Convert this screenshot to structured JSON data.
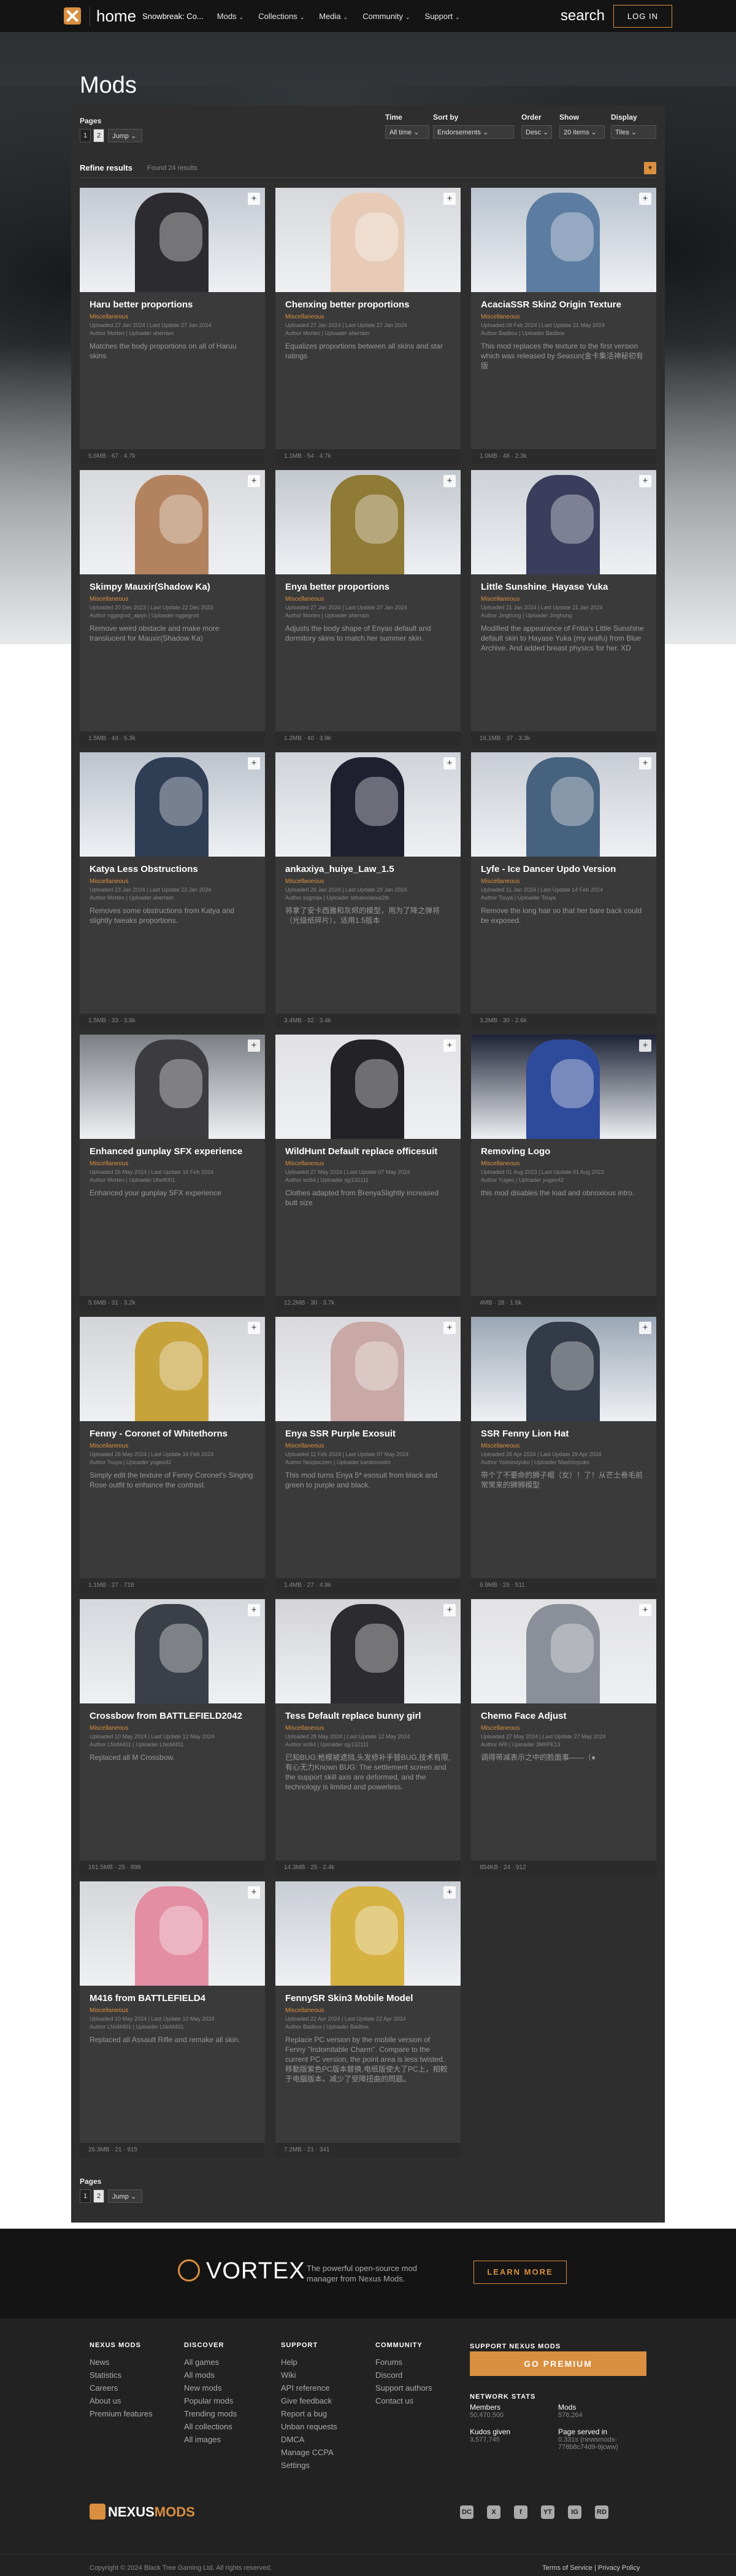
{
  "header": {
    "home": "home",
    "game": "Snowbreak: Co...",
    "nav": [
      "Mods",
      "Collections",
      "Media",
      "Community",
      "Support"
    ],
    "search": "search",
    "login": "LOG IN"
  },
  "title": "Mods",
  "filters": {
    "pages_label": "Pages",
    "pages": [
      "1",
      "2"
    ],
    "jump": "Jump",
    "time_label": "Time",
    "time_value": "All time",
    "sort_label": "Sort by",
    "sort_value": "Endorsements",
    "order_label": "Order",
    "order_value": "Desc",
    "show_label": "Show",
    "show_value": "20 items",
    "display_label": "Display",
    "display_value": "Tiles"
  },
  "refine": {
    "title": "Refine results",
    "count": "Found 24 results"
  },
  "mods": [
    {
      "name": "Haru better proportions",
      "category": "Miscellaneous",
      "dates": "Uploaded 27 Jan 2024 | Last Update 27 Jan 2024",
      "people": "Author Morten | Uploader aherram",
      "desc": "Matches the body proportions on all of Haruu skins",
      "stats": "5.6MB  ·  67  ·  4.7k",
      "bg": "#c4c9d3",
      "fig": "#2b2b30"
    },
    {
      "name": "Chenxing better proportions",
      "category": "Miscellaneous",
      "dates": "Uploaded 27 Jan 2024 | Last Update 27 Jan 2024",
      "people": "Author Morten | Uploader aherram",
      "desc": "Equalizes proportions between all skins and star ratings",
      "stats": "1.1MB  ·  54  ·  4.7k",
      "bg": "#d7d8dc",
      "fig": "#e7cbb6"
    },
    {
      "name": "AcaciaSSR Skin2 Origin Texture",
      "category": "Miscellaneous",
      "dates": "Uploaded 09 Feb 2024 | Last Update 21 May 2024",
      "people": "Author Badbox | Uploader Badbox",
      "desc": "This mod replaces the texture to the first version which was released by Seasun(金卡集活神秘初有版",
      "stats": "1.0MB  ·  48  ·  2.3k",
      "bg": "#b9c3cf",
      "fig": "#5c7da1"
    },
    {
      "name": "Skimpy Mauxir(Shadow Ka)",
      "category": "Miscellaneous",
      "dates": "Uploaded 20 Dec 2023 | Last Update 22 Dec 2023",
      "people": "Author nggegrod_alpyn | Uploader nggegrod",
      "desc": "Remove weird obstacle and make more translucent for Mauxir(Shadow Ka)",
      "stats": "1.5MB  ·  44  ·  5.3k",
      "bg": "#d8d9dd",
      "fig": "#b3835f"
    },
    {
      "name": "Enya better proportions",
      "category": "Miscellaneous",
      "dates": "Uploaded 27 Jan 2024 | Last Update 27 Jan 2024",
      "people": "Author Morten | Uploader aherram",
      "desc": "Adjusts the body shape of Enyas default and dormitory skins to match her summer skin.",
      "stats": "1.2MB  ·  40  ·  3.9k",
      "bg": "#c3c8cf",
      "fig": "#8f7a36"
    },
    {
      "name": "Little Sunshine_Hayase Yuka",
      "category": "Miscellaneous",
      "dates": "Uploaded 21 Jan 2024 | Last Update 21 Jan 2024",
      "people": "Author Jinghung | Uploader Jinghung",
      "desc": "Modified the appearance of Fritia's Little Sunshine default skin to Hayase Yuka (my waifu) from Blue Archive. And added breast physics for her. XD",
      "stats": "16.1MB  ·  37  ·  3.3k",
      "bg": "#cdd1d8",
      "fig": "#3a3d5c"
    },
    {
      "name": "Katya Less Obstructions",
      "category": "Miscellaneous",
      "dates": "Uploaded 23 Jan 2024 | Last Update 23 Jan 2024",
      "people": "Author Morten | Uploader aherram",
      "desc": "Removes some obstructions from Katya and slightly tweaks proportions.",
      "stats": "1.5MB  ·  33  ·  3.8k",
      "bg": "#bcc3cd",
      "fig": "#2f3d55"
    },
    {
      "name": "ankaxiya_huiye_Law_1.5",
      "category": "Miscellaneous",
      "dates": "Uploaded 26 Jan 2024 | Last Update 29 Jan 2024",
      "people": "Author ssgmax | Uploader sbhaoxiaoxa2tb",
      "desc": "将拿了安卡西雅和灰烬的模型，用为了降之弹将（光级纸碎片）。适用1.5版本",
      "stats": "3.4MB  ·  32  ·  3.4k",
      "bg": "#d0d3d9",
      "fig": "#1e2030"
    },
    {
      "name": "Lyfe - Ice Dancer Updo Version",
      "category": "Miscellaneous",
      "dates": "Uploaded 11 Jan 2024 | Last Update 14 Feb 2024",
      "people": "Author Tsuya | Uploader Tsuya",
      "desc": "Remove the long hair so that her bare back could be exposed.",
      "stats": "3.2MB  ·  30  ·  2.6k",
      "bg": "#c8ccd4",
      "fig": "#47627e"
    },
    {
      "name": "Enhanced gunplay SFX experience",
      "category": "Miscellaneous",
      "dates": "Uploaded 26 May 2024 | Last Update 16 Feb 2024",
      "people": "Author Morten | Uploader Ubelt001",
      "desc": "Enhanced your gunplay SFX experience",
      "stats": "5.6MB  ·  31  ·  3.2k",
      "bg": "#7b7e84",
      "fig": "#3c3c40"
    },
    {
      "name": "WildHunt Default replace officesuit",
      "category": "Miscellaneous",
      "dates": "Uploaded 27 May 2024 | Last Update 07 May 2024",
      "people": "Author sci64 | Uploader sjy132111",
      "desc": "Clothes adapted from BrenyaSlightly increased butt size",
      "stats": "12.2MB  ·  30  ·  3.7k",
      "bg": "#e1e1e4",
      "fig": "#222227"
    },
    {
      "name": "Removing Logo",
      "category": "Miscellaneous",
      "dates": "Uploaded 01 Aug 2023 | Last Update 01 Aug 2023",
      "people": "Author Yugeo | Uploader yugeo42",
      "desc": "this mod disables the load and obnoxious intro.",
      "stats": "4MB  ·  28  ·  1.6k",
      "bg": "#1d2336",
      "fig": "#2e4a9a"
    },
    {
      "name": "Fenny - Coronet of Whitethorns",
      "category": "Miscellaneous",
      "dates": "Uploaded 26 May 2024 | Last Update 16 Feb 2024",
      "people": "Author Tsuya | Uploader yugeo42",
      "desc": "Simply edit the texture of Fenny Coronet's Singing Rose outfit to enhance the contrast.",
      "stats": "1.1MB  ·  27  ·  718",
      "bg": "#d3d4d8",
      "fig": "#c7a33c"
    },
    {
      "name": "Enya SSR Purple Exosuit",
      "category": "Miscellaneous",
      "dates": "Uploaded 11 Feb 2024 | Last Update 07 May 2024",
      "people": "Author Nezpoczem | Uploader kardoovsdm",
      "desc": "This mod turns Enya 5* exosuit from black and green to purple and black.",
      "stats": "1.4MB  ·  27  ·  4.9k",
      "bg": "#d9d9dd",
      "fig": "#c8a9a5"
    },
    {
      "name": "SSR Fenny Lion Hat",
      "category": "Miscellaneous",
      "dates": "Uploaded 26 Apr 2024 | Last Update 29 Apr 2024",
      "people": "Author Yoshinoyuko | Uploader Mashiroyuko",
      "desc": "带个了不要命的狮子帽（女）！了！从芒士卷毛前常常来的狮狮模型",
      "stats": "6.9MB  ·  26  ·  511",
      "bg": "#9ba7b6",
      "fig": "#333a48"
    },
    {
      "name": "Crossbow from BATTLEFIELD2042",
      "category": "Miscellaneous",
      "dates": "Uploaded 10 May 2024 | Last Update 12 May 2024",
      "people": "Author LNoM401 | Uploader LNoM401",
      "desc": "Replaced all M Crossbow.",
      "stats": "161.5MB  ·  25  ·  998",
      "bg": "#d5d7dc",
      "fig": "#3a3f48"
    },
    {
      "name": "Tess Default replace bunny girl",
      "category": "Miscellaneous",
      "dates": "Uploaded 28 May 2024 | Last Update 12 May 2024",
      "people": "Author sci64 | Uploader sjy132111",
      "desc": "已知BUG:枪模被遮挡,头发修补手替BUG,技术有限,有心无力Known BUG: The settlement screen and the support skill axis are deformed, and the technology is limited and powerless.",
      "stats": "14.3MB  ·  25  ·  2.4k",
      "bg": "#d4d4d8",
      "fig": "#2b2b30"
    },
    {
      "name": "Chemo Face Adjust",
      "category": "Miscellaneous",
      "dates": "Uploaded 27 May 2024 | Last Update 27 May 2024",
      "people": "Author ARI | Uploader 3MIIPE13",
      "desc": "调得带减表示之中的脸面事——（●",
      "stats": "854KB  ·  24  ·  912",
      "bg": "#e2e2e4",
      "fig": "#8a8f99"
    },
    {
      "name": "M416 from BATTLEFIELD4",
      "category": "Miscellaneous",
      "dates": "Uploaded 10 May 2024 | Last Update 10 May 2024",
      "people": "Author LNoM401 | Uploader LNoM401",
      "desc": "Replaced all Assault Rifle and remake all skin.",
      "stats": "26.3MB  ·  21  ·  915",
      "bg": "#d6d7db",
      "fig": "#e38ea3"
    },
    {
      "name": "FennySR Skin3 Mobile Model",
      "category": "Miscellaneous",
      "dates": "Uploaded 22 Apr 2024 | Last Update 22 Apr 2024",
      "people": "Author Badbox | Uploader Badbox",
      "desc": "Replace PC version by the mobile version of Fenny \"Indomitable Charm\". Compare to the current PC version, the point area is less twisted.移動版紫色PC版本替换,电纸版使大了PC上，相較于电腦版本，减少了受障扭曲的問题。",
      "stats": "7.2MB  ·  21  ·  341",
      "bg": "#c9cdd5",
      "fig": "#d6b243"
    }
  ],
  "vortex": {
    "name": "VORTEX",
    "desc": "The powerful open-source mod manager from Nexus Mods.",
    "learn": "LEARN MORE"
  },
  "footer": {
    "cols": [
      {
        "h": "NEXUS MODS",
        "items": [
          "News",
          "Statistics",
          "Careers",
          "About us",
          "Premium features"
        ]
      },
      {
        "h": "DISCOVER",
        "items": [
          "All games",
          "All mods",
          "New mods",
          "Popular mods",
          "Trending mods",
          "All collections",
          "All images"
        ]
      },
      {
        "h": "SUPPORT",
        "items": [
          "Help",
          "Wiki",
          "API reference",
          "Give feedback",
          "Report a bug",
          "Unban requests",
          "DMCA",
          "Manage CCPA",
          "Settings"
        ]
      },
      {
        "h": "COMMUNITY",
        "items": [
          "Forums",
          "Discord",
          "Support authors",
          "Contact us"
        ]
      }
    ],
    "support_h": "SUPPORT NEXUS MODS",
    "premium": "GO PREMIUM",
    "network_h": "NETWORK STATS",
    "members_l": "Members",
    "members_v": "50,470,500",
    "mods_l": "Mods",
    "mods_v": "576,264",
    "kudos_l": "Kudos given",
    "kudos_v": "3,577,745",
    "served_l": "Page served in",
    "served_v": "0.331s (newsmods-778b8c74d9-9jcww)",
    "logo_a": "NEXUS",
    "logo_b": "MODS",
    "socials": [
      "DC",
      "X",
      "f",
      "YT",
      "IG",
      "RD"
    ],
    "copyright": "Copyright © 2024 Black Tree Gaming Ltd. All rights reserved.",
    "terms": "Terms of Service | Privacy Policy"
  }
}
